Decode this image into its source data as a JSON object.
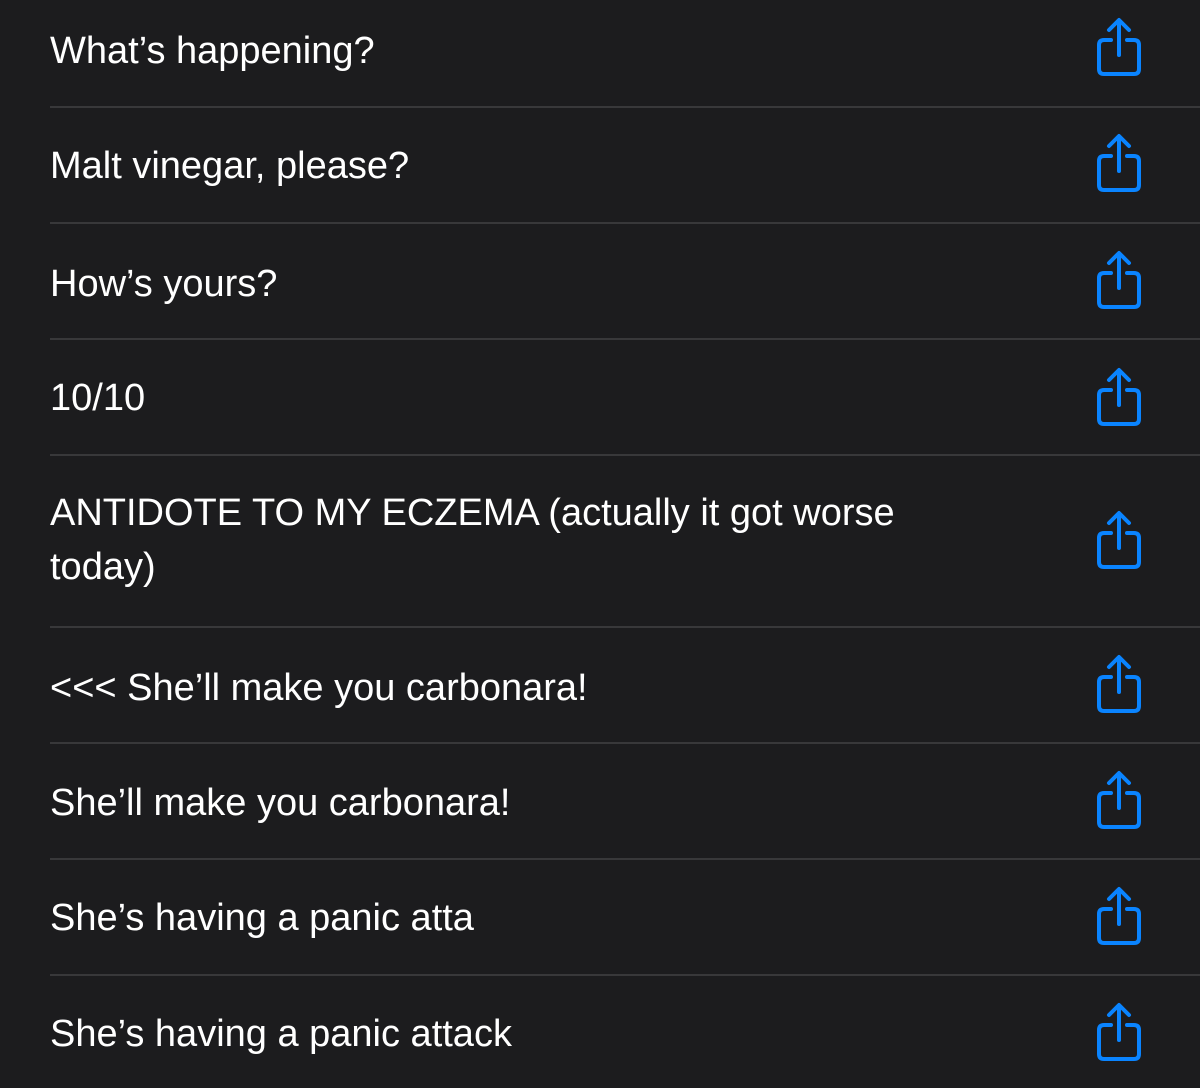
{
  "list": {
    "items": [
      {
        "text": "What’s happening?"
      },
      {
        "text": "Malt vinegar, please?"
      },
      {
        "text": "How’s yours?"
      },
      {
        "text": "10/10"
      },
      {
        "text": "ANTIDOTE TO MY ECZEMA (actually it got worse today)"
      },
      {
        "text": "<<< She’ll make you carbonara!"
      },
      {
        "text": "She’ll make you carbonara!"
      },
      {
        "text": "She’s having a panic atta"
      },
      {
        "text": "She’s having a panic attack"
      }
    ],
    "share_icon": "share-icon"
  },
  "colors": {
    "background": "#1c1c1e",
    "text": "#ffffff",
    "accent": "#0a84ff",
    "separator": "#38383a"
  }
}
